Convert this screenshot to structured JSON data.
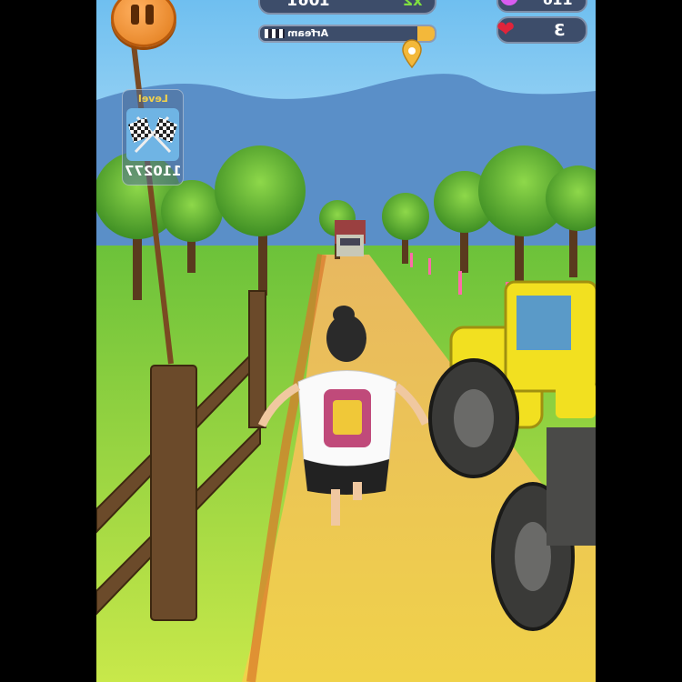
{
  "hud": {
    "score": "1061",
    "multiplier": "x2",
    "gems": "116",
    "lives": "3",
    "progress_name": "Arfeam",
    "progress_fraction": 0.1,
    "level_label": "Level",
    "level_number": "110277"
  },
  "icons": {
    "pause": "pause-icon",
    "gem": "gem-icon",
    "heart": "heart-icon",
    "checkered_flags": "checkered-flags-icon",
    "progress_marker": "location-pin-icon"
  },
  "colors": {
    "pause_button": "#e8862a",
    "hud_pill": "#3d4d6a",
    "progress_fill": "#f3b83a",
    "multiplier": "#7fe040",
    "gem": "#d85cf0",
    "heart": "#e0243a"
  }
}
